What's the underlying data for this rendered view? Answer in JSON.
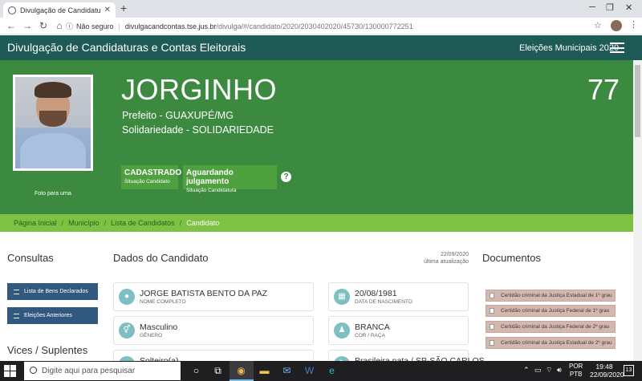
{
  "browser": {
    "tab_title": "Divulgação de Candidaturas e C",
    "new_tab": "+",
    "insecure_label": "Não seguro",
    "url_host": "divulgacandcontas.tse.jus.br",
    "url_path": "/divulga/#/candidato/2020/2030402020/45730/130000772251"
  },
  "site": {
    "brand": "Divulgação de Candidaturas e Contas Eleitorais",
    "election": "Eleições Municipais 2020"
  },
  "candidate": {
    "name": "JORGINHO",
    "number": "77",
    "position": "Prefeito - GUAXUPÉ/MG",
    "party": "Solidariedade - SOLIDARIEDADE",
    "photo_caption": "Foto para urna",
    "status": [
      {
        "value": "CADASTRADO",
        "label": "Situação Candidato"
      },
      {
        "value": "Aguardando julgamento",
        "label": "Situação Candidatura"
      }
    ],
    "help": "?"
  },
  "breadcrumb": [
    "Página Inicial",
    "Município",
    "Lista de Candidatos",
    "Candidato"
  ],
  "consultas": {
    "title": "Consultas",
    "buttons": [
      "Lista de Bens Declarados",
      "Eleições Anteriores"
    ],
    "vices_title": "Vices / Suplentes"
  },
  "dados": {
    "title": "Dados do Candidato",
    "update_date": "22/09/2020",
    "update_label": "última atualização",
    "fields": [
      {
        "value": "JORGE BATISTA BENTO DA PAZ",
        "label": "NOME COMPLETO"
      },
      {
        "value": "20/08/1981",
        "label": "DATA DE NASCIMENTO"
      },
      {
        "value": "Masculino",
        "label": "GÊNERO"
      },
      {
        "value": "BRANCA",
        "label": "COR / RAÇA"
      },
      {
        "value": "Solteiro(a)",
        "label": ""
      },
      {
        "value": "Brasileira nata / SP-SÃO CARLOS",
        "label": ""
      }
    ]
  },
  "documentos": {
    "title": "Documentos",
    "items": [
      "Certidão criminal da Justiça Estadual de 1º grau",
      "Certidão criminal da Justiça Federal de 1º grau",
      "Certidão criminal da Justiça Federal de 2º grau",
      "Certidão criminal da Justiça Estadual de 2º grau"
    ]
  },
  "taskbar": {
    "search_placeholder": "Digite aqui para pesquisar",
    "lang_top": "POR",
    "lang_bottom": "PTB",
    "time": "19:48",
    "date": "22/09/2020",
    "notifications": "13"
  }
}
